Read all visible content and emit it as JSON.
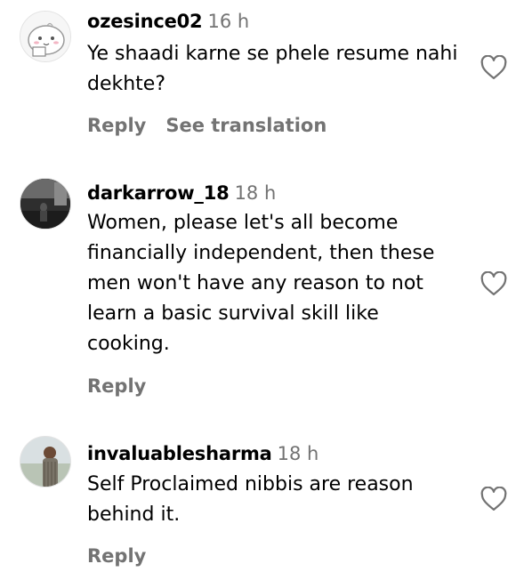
{
  "comments": [
    {
      "username": "ozesince02",
      "time": "16 h",
      "text": "Ye shaadi karne se phele resume nahi dekhte?",
      "actions": {
        "reply": "Reply",
        "translate": "See translation"
      }
    },
    {
      "username": "darkarrow_18",
      "time": "18 h",
      "text": "Women, please let's all become financially independent, then these men won't have any reason to not learn a basic survival skill like cooking.",
      "actions": {
        "reply": "Reply"
      }
    },
    {
      "username": "invaluablesharma",
      "time": "18 h",
      "text": "Self Proclaimed nibbis are reason behind it.",
      "actions": {
        "reply": "Reply"
      }
    }
  ],
  "icons": {
    "like": "heart-outline-icon"
  },
  "colors": {
    "text": "#000000",
    "secondary": "#737373",
    "background": "#ffffff"
  }
}
